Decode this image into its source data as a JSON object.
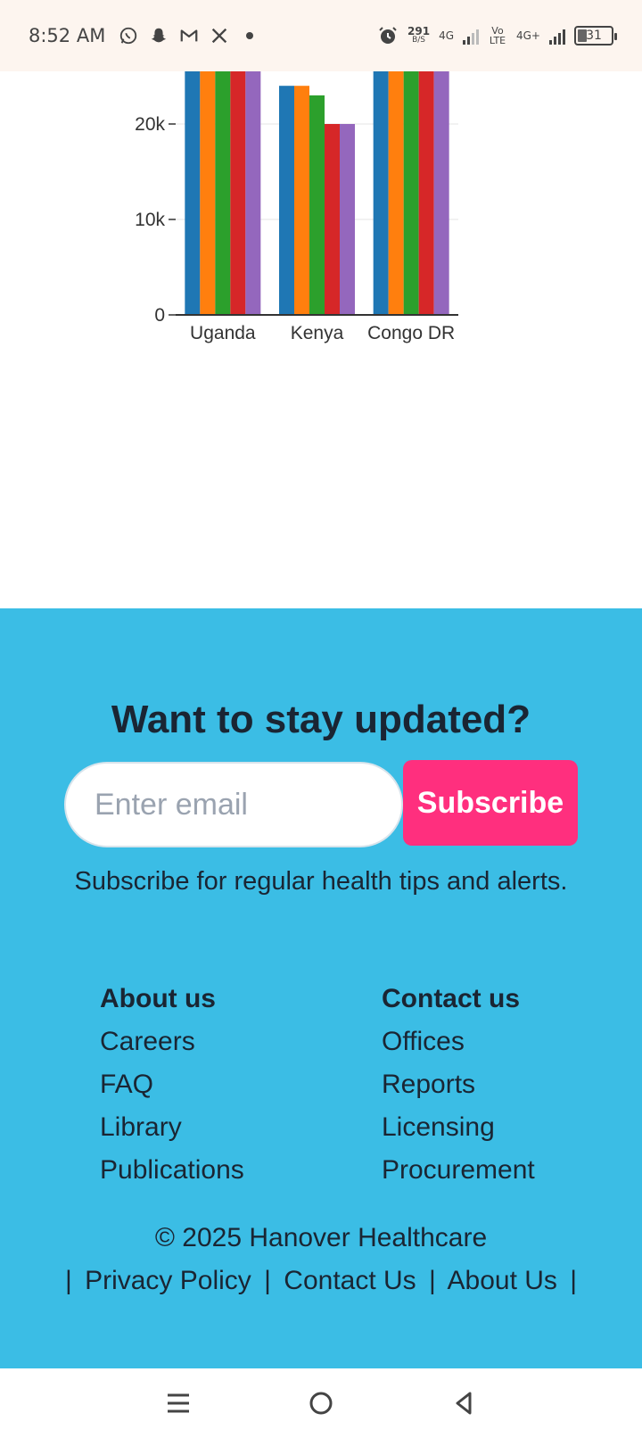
{
  "status_bar": {
    "time": "8:52 AM",
    "net_speed_value": "291",
    "net_speed_unit": "B/S",
    "network_1": "4G",
    "network_2": "Vo LTE",
    "network_3": "4G+",
    "battery": "31",
    "notification_icons": [
      "whatsapp-icon",
      "snapchat-icon",
      "gmail-icon",
      "x-icon",
      "dot-icon"
    ]
  },
  "chart_data": {
    "type": "bar",
    "categories": [
      "Uganda",
      "Kenya",
      "Congo DR"
    ],
    "series": [
      {
        "color": "#1f77b4",
        "values": [
          26000,
          24000,
          26000
        ]
      },
      {
        "color": "#ff7f0e",
        "values": [
          26000,
          24000,
          26000
        ]
      },
      {
        "color": "#2ca02c",
        "values": [
          26000,
          23000,
          26000
        ]
      },
      {
        "color": "#d62728",
        "values": [
          26000,
          20000,
          26000
        ]
      },
      {
        "color": "#9467bd",
        "values": [
          26000,
          20000,
          26000
        ]
      }
    ],
    "y_ticks": [
      "0",
      "10k",
      "20k"
    ],
    "ylim_visible": [
      0,
      25900
    ],
    "grid": true
  },
  "newsletter": {
    "title": "Want to stay updated?",
    "email_placeholder": "Enter email",
    "subscribe_label": "Subscribe",
    "subtitle": "Subscribe for regular health tips and alerts."
  },
  "footer_links": {
    "col1": {
      "heading": "About us",
      "links": [
        "Careers",
        "FAQ",
        "Library",
        "Publications"
      ]
    },
    "col2": {
      "heading": "Contact us",
      "links": [
        "Offices",
        "Reports",
        "Licensing",
        "Procurement"
      ]
    }
  },
  "copyright": "© 2025 Hanover Healthcare",
  "legal_links": [
    "Privacy Policy",
    "Contact Us",
    "About Us"
  ],
  "legal_separator": "|",
  "colors": {
    "footer_bg": "#3bbde5",
    "subscribe_bg": "#ff2f7e",
    "text_dark": "#1a2533"
  },
  "nav_bar": [
    "menu-icon",
    "home-icon",
    "back-icon"
  ]
}
